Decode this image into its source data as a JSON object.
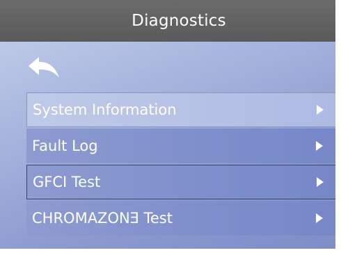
{
  "header": {
    "title": "Diagnostics"
  },
  "back": {
    "icon": "back-arrow-icon"
  },
  "menu": {
    "items": [
      {
        "label": "System Information",
        "icon": "chevron-right-icon"
      },
      {
        "label": "Fault Log",
        "icon": "chevron-right-icon"
      },
      {
        "label": "GFCI Test",
        "icon": "chevron-right-icon"
      },
      {
        "label": "CHROMAZONƎ Test",
        "icon": "chevron-right-icon"
      }
    ]
  },
  "colors": {
    "header_bg": "#5f5f5f",
    "background": "#97a5d6",
    "text": "#ffffff"
  }
}
